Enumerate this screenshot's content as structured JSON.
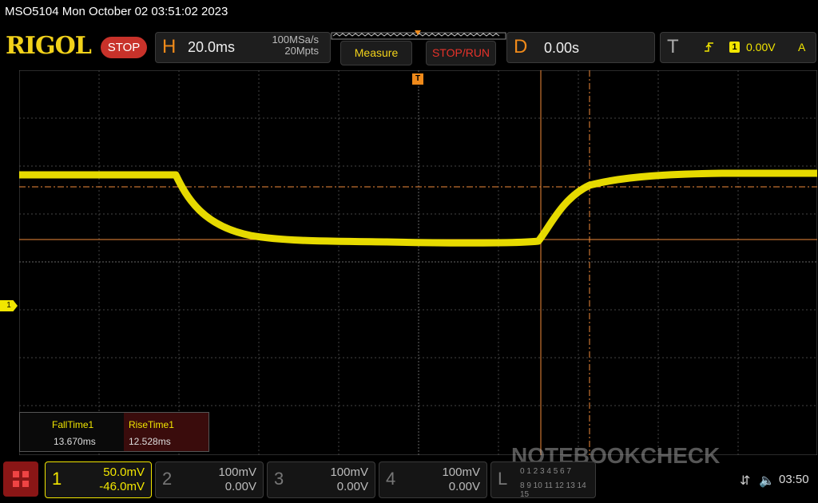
{
  "header": {
    "title": "MSO5104  Mon October 02 03:51:02 2023",
    "logo": "RIGOL",
    "status": "STOP"
  },
  "horizontal": {
    "letter": "H",
    "timebase": "20.0ms",
    "sample_rate": "100MSa/s",
    "memory_depth": "20Mpts"
  },
  "menu": {
    "measure_label": "Measure",
    "stoprun_label": "STOP/RUN"
  },
  "delay": {
    "letter": "D",
    "value": "0.00s"
  },
  "trigger": {
    "letter": "T",
    "source": "1",
    "level": "0.00V",
    "mode": "A"
  },
  "channel_marker": "1",
  "measurements": [
    {
      "name": "FallTime1",
      "value": "13.670ms"
    },
    {
      "name": "RiseTime1",
      "value": "12.528ms"
    }
  ],
  "channels": [
    {
      "num": "1",
      "scale": "50.0mV",
      "offset": "-46.0mV"
    },
    {
      "num": "2",
      "scale": "100mV",
      "offset": "0.00V"
    },
    {
      "num": "3",
      "scale": "100mV",
      "offset": "0.00V"
    },
    {
      "num": "4",
      "scale": "100mV",
      "offset": "0.00V"
    }
  ],
  "logic": {
    "letter": "L",
    "row1": "0 1 2 3 4 5 6 7",
    "row2": "8 9 10 11 12 13 14 15"
  },
  "system": {
    "time": "03:50"
  },
  "watermark": "NOTEBOOKCHECK",
  "colors": {
    "ch1": "#f2e600",
    "cursor": "#f08a3a",
    "brand_yellow": "#f2d21a",
    "stop_red": "#c8322a"
  }
}
